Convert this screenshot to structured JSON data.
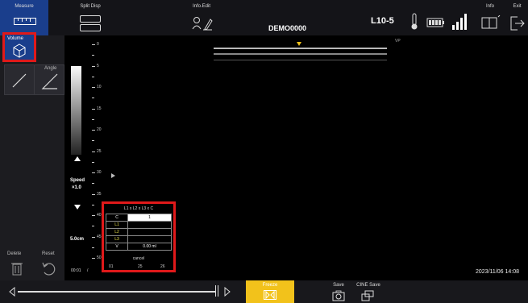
{
  "topbar": {
    "measure_label": "Measure",
    "split_label": "Split Disp",
    "info_edit_label": "Info.Edit",
    "patient_id": "DEMO0000",
    "probe": "L10-5",
    "info_label": "Info",
    "exit_label": "Exit"
  },
  "sidebar": {
    "volume_label": "Volume",
    "angle_label": "Angle",
    "delete_label": "Delete",
    "reset_label": "Reset"
  },
  "scale": {
    "marks": [
      "0",
      "5",
      "10",
      "15",
      "20",
      "25",
      "30",
      "35",
      "40",
      "45",
      "50"
    ],
    "speed_label": "Speed",
    "speed_value": "×1.0",
    "depth": "5.0cm",
    "time_start": "00:01",
    "time_sep": "/"
  },
  "marker": "VP",
  "measure_table": {
    "title": "L1 x L2 x L3 x C",
    "rows": [
      {
        "label": "C",
        "value": "1"
      },
      {
        "label": "L1",
        "value": ""
      },
      {
        "label": "L2",
        "value": ""
      },
      {
        "label": "L3",
        "value": ""
      },
      {
        "label": "V",
        "value": "0.00 ml"
      }
    ],
    "cancel_label": "cancel"
  },
  "timeline_partial": [
    "01",
    "25",
    "26"
  ],
  "timestamp": "2023/11/06 14:08",
  "bottombar": {
    "freeze_label": "Freeze",
    "save_label": "Save",
    "cine_save_label": "CINE Save"
  },
  "colors": {
    "accent": "#1a3e8c",
    "highlight": "#e0191a",
    "freeze": "#f2c21b"
  }
}
